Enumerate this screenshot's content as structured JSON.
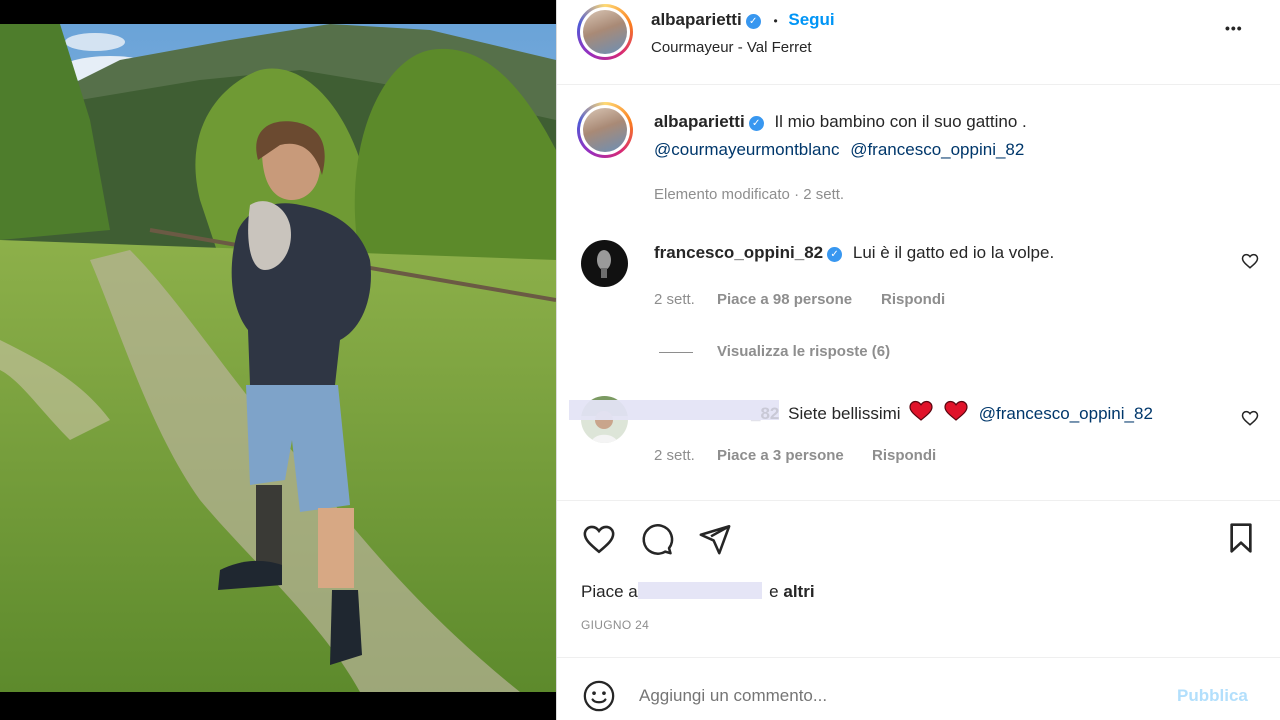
{
  "post": {
    "author": "albaparietti",
    "dot": "•",
    "follow_label": "Segui",
    "location": "Courmayeur - Val Ferret",
    "more_label": "•••"
  },
  "caption": {
    "username": "albaparietti",
    "text": "Il mio bambino con il suo gattino .",
    "mention_1": "@courmayeurmontblanc",
    "mention_2": "@francesco_oppini_82",
    "meta": "Elemento modificato · 2 sett."
  },
  "comments": [
    {
      "username": "francesco_oppini_82",
      "text": "Lui è il gatto ed io la volpe.",
      "time": "2 sett.",
      "likes": "Piace a 98 persone",
      "reply_label": "Rispondi",
      "view_replies": "Visualizza le risposte (6)"
    },
    {
      "username_partial": "_82",
      "text": "Siete bellissimi",
      "mention": "@francesco_oppini_82",
      "time": "2 sett.",
      "likes": "Piace a 3 persone",
      "reply_label": "Rispondi"
    }
  ],
  "likes": {
    "prefix": "Piace a",
    "suffix": "e",
    "others": "altri"
  },
  "date": "GIUGNO 24",
  "composer": {
    "placeholder": "Aggiungi un commento...",
    "publish_label": "Pubblica"
  },
  "icons": [
    "heart-icon",
    "comment-icon",
    "share-icon",
    "bookmark-icon",
    "emoji-icon",
    "verified-icon",
    "more-icon"
  ],
  "colors": {
    "verified": "#3897f0",
    "follow": "#0095f6",
    "mention": "#00376b",
    "publish_disabled": "#b2dffc",
    "heart_emoji": "#e0132a"
  }
}
